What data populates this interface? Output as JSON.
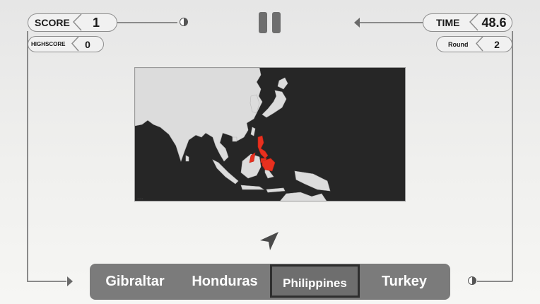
{
  "hud": {
    "score_label": "SCORE",
    "score_value": "1",
    "highscore_label": "HIGHSCORE",
    "highscore_value": "0",
    "time_label": "TIME",
    "time_value": "48.6",
    "round_label": "Round",
    "round_value": "2"
  },
  "map": {
    "highlight_color": "#e8301f",
    "land_color": "#dcdcdc",
    "sea_color": "#262626"
  },
  "options": [
    {
      "label": "Gibraltar",
      "selected": false
    },
    {
      "label": "Honduras",
      "selected": false
    },
    {
      "label": "Philippines",
      "selected": true
    },
    {
      "label": "Turkey",
      "selected": false
    }
  ]
}
